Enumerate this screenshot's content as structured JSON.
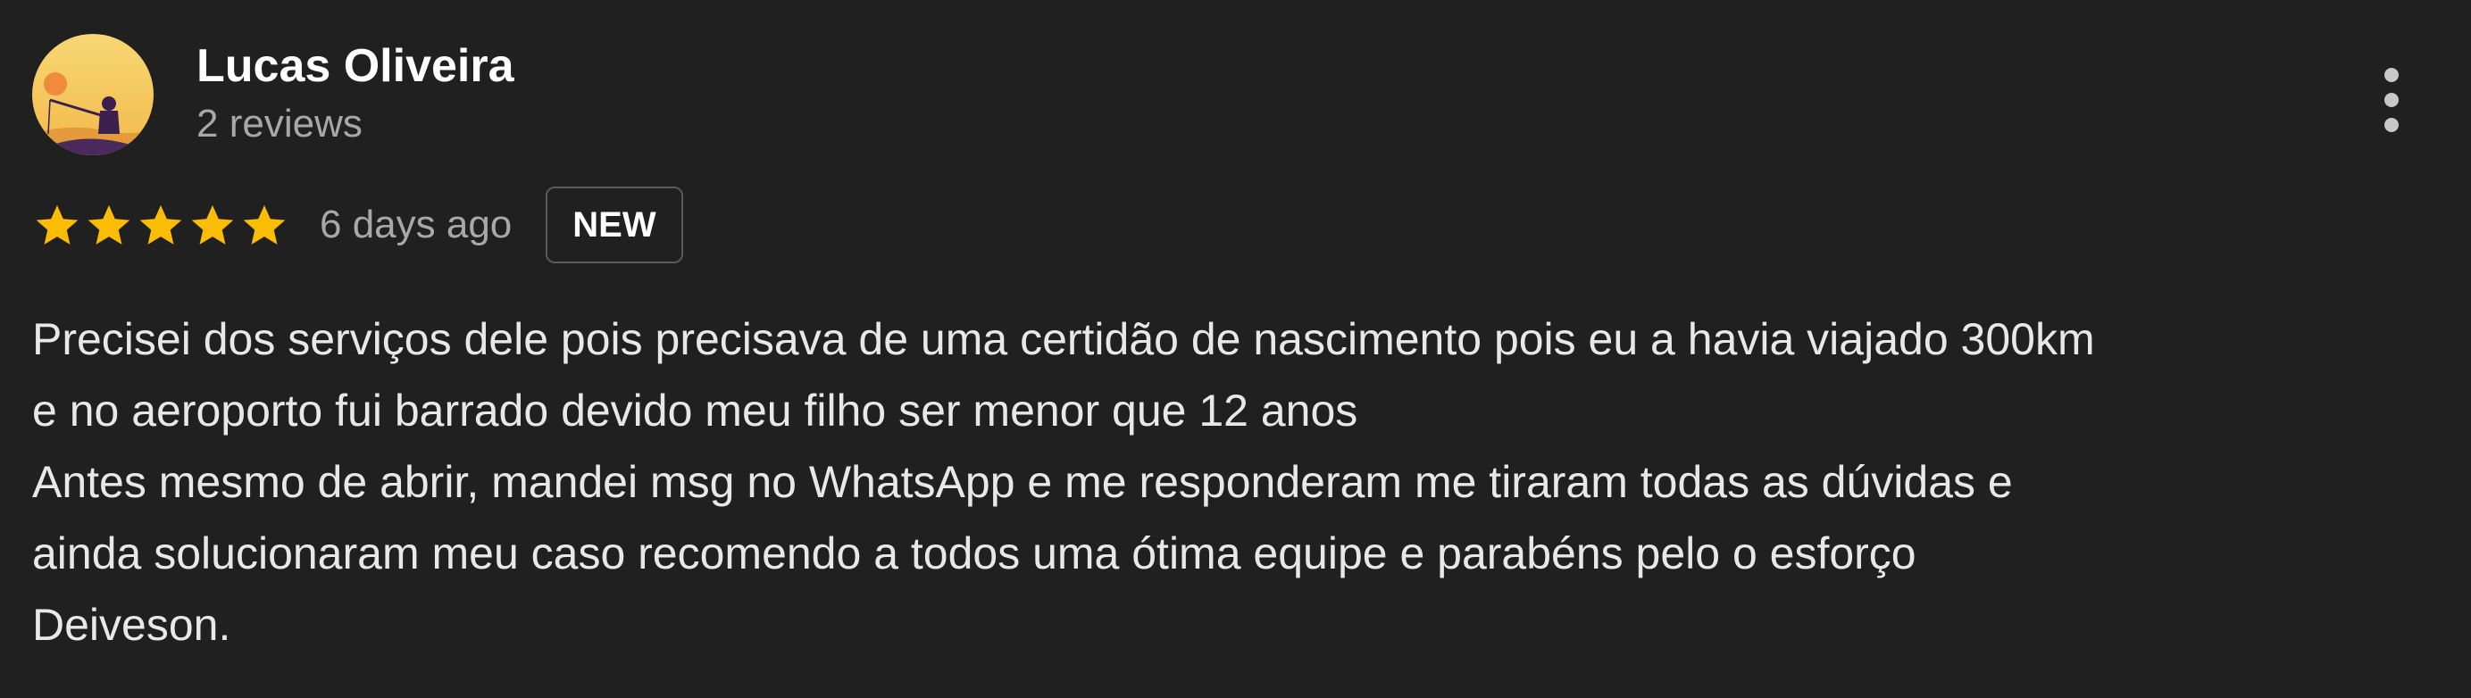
{
  "review": {
    "author": {
      "name": "Lucas Oliveira",
      "meta": "2 reviews",
      "avatar_icon": "fisherman-sunset-avatar"
    },
    "rating": 5,
    "max_rating": 5,
    "time_ago": "6 days ago",
    "badge": "NEW",
    "text_lines": [
      "Precisei dos serviços dele pois precisava de uma certidão de nascimento pois eu a havia viajado 300km",
      "e no aeroporto fui barrado devido meu filho ser menor que 12 anos",
      "Antes mesmo de abrir, mandei msg no WhatsApp e me responderam me tiraram todas as dúvidas e",
      "ainda solucionaram meu caso recomendo a todos uma ótima equipe e parabéns pelo o esforço",
      "Deiveson."
    ]
  },
  "colors": {
    "background": "#202020",
    "star": "#fbbc04",
    "primary_text": "#e8e8e8",
    "secondary_text": "#a8a8a8"
  },
  "icons": {
    "more": "more-vert-icon",
    "star": "star-icon"
  }
}
